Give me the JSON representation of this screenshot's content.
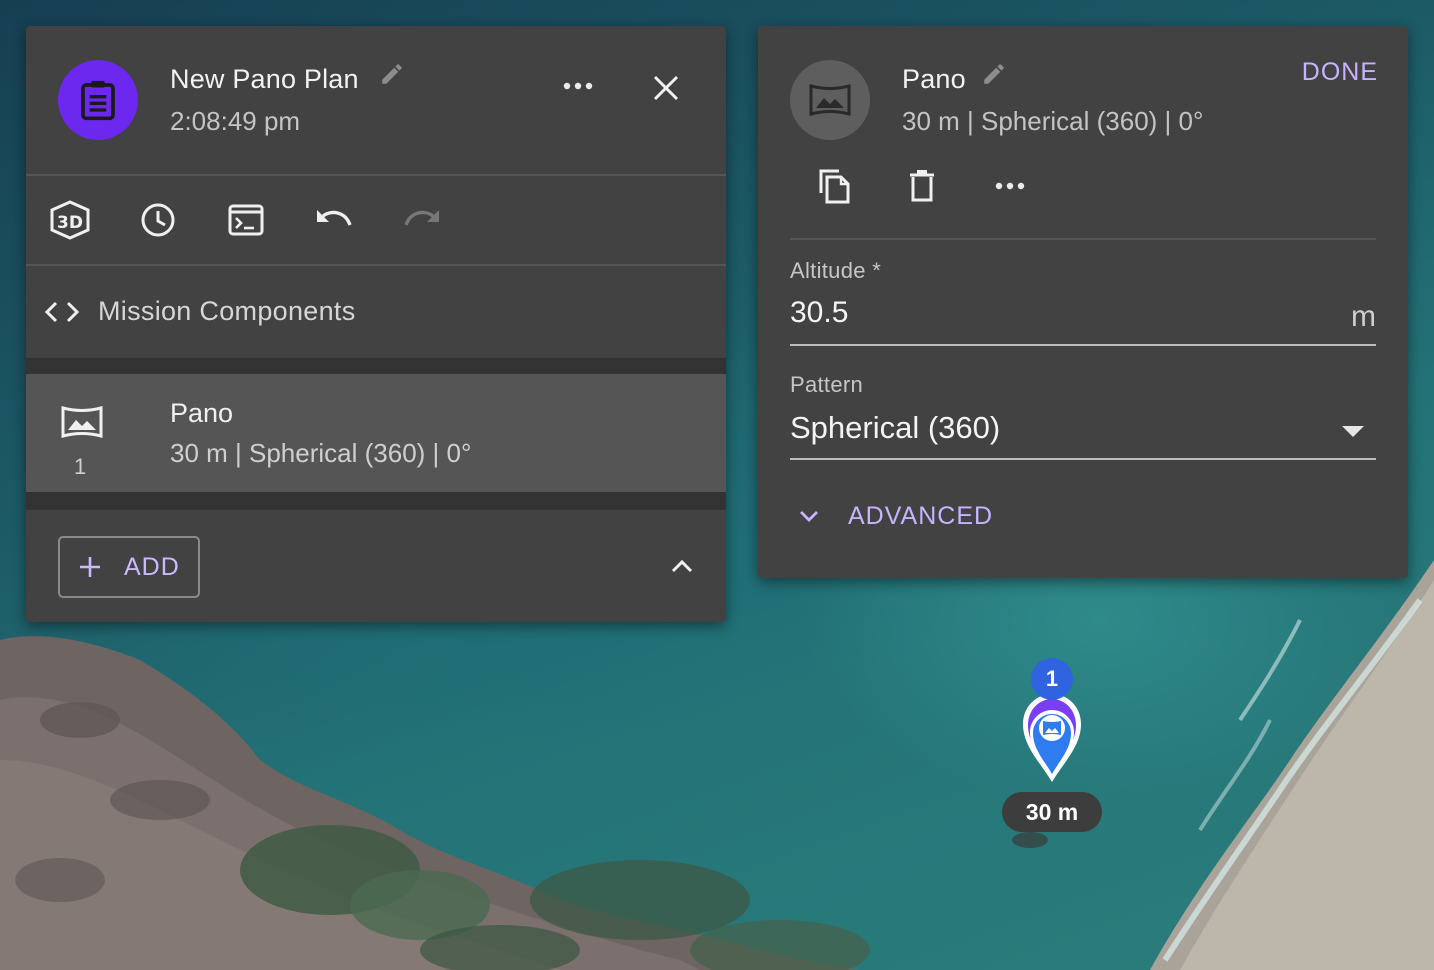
{
  "plan": {
    "title": "New Pano Plan",
    "time": "2:08:49 pm",
    "components_label": "Mission Components",
    "items": [
      {
        "index": "1",
        "title": "Pano",
        "subtitle": "30 m | Spherical (360) | 0°",
        "icon": "panorama-icon"
      }
    ],
    "add_label": "ADD",
    "toolbar_icons": [
      "3d-view-icon",
      "clock-icon",
      "console-icon",
      "undo-icon",
      "redo-icon"
    ]
  },
  "pano": {
    "title": "Pano",
    "subtitle": "30 m | Spherical (360) | 0°",
    "done_label": "DONE",
    "altitude_label": "Altitude *",
    "altitude_value": "30.5",
    "altitude_unit": "m",
    "pattern_label": "Pattern",
    "pattern_value": "Spherical (360)",
    "advanced_label": "ADVANCED"
  },
  "map": {
    "marker_index": "1",
    "marker_label": "30 m"
  },
  "colors": {
    "panel_bg": "#424242",
    "plan_avatar": "#6d28f0",
    "accent_text": "#c7b3ff",
    "marker_blue": "#2f63e0",
    "marker_purple": "#6d28f0"
  }
}
